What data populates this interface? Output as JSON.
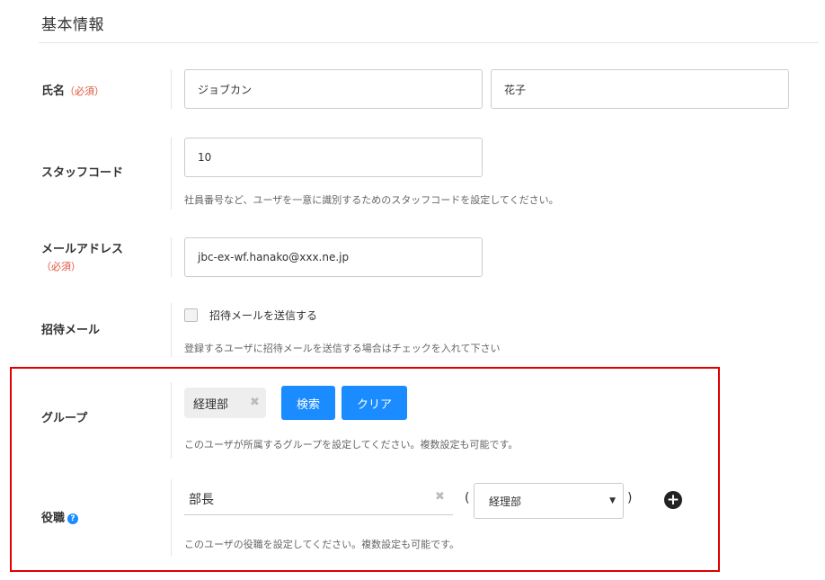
{
  "section": {
    "title": "基本情報"
  },
  "name": {
    "label": "氏名",
    "required": "（必須）",
    "last_name": "ジョブカン",
    "first_name": "花子"
  },
  "staff_code": {
    "label": "スタッフコード",
    "value": "10",
    "help": "社員番号など、ユーザを一意に識別するためのスタッフコードを設定してください。"
  },
  "email": {
    "label": "メールアドレス",
    "required": "（必須）",
    "value": "jbc-ex-wf.hanako@xxx.ne.jp"
  },
  "invite": {
    "label": "招待メール",
    "checkbox_label": "招待メールを送信する",
    "checked": false,
    "help": "登録するユーザに招待メールを送信する場合はチェックを入れて下さい"
  },
  "group": {
    "label": "グループ",
    "chip": "経理部",
    "chip_remove": "✖",
    "search_button": "検索",
    "clear_button": "クリア",
    "help": "このユーザが所属するグループを設定してください。複数設定も可能です。"
  },
  "role": {
    "label": "役職",
    "help_icon": "?",
    "value": "部長",
    "clear": "✖",
    "paren_open": "(",
    "paren_close": ")",
    "group_select": "経理部",
    "select_arrow": "▼",
    "add": "+",
    "help": "このユーザの役職を設定してください。複数設定も可能です。"
  },
  "colors": {
    "accent": "#1a8cff",
    "required": "#e0533b",
    "highlight": "#e00000"
  }
}
